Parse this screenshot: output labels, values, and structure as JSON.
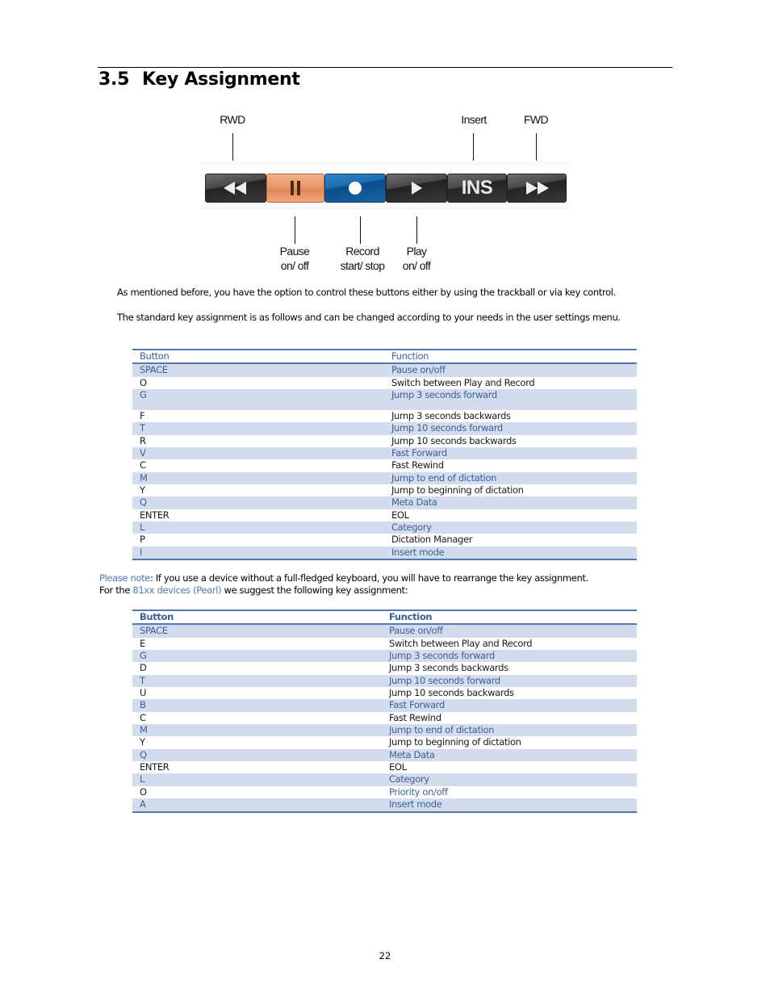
{
  "section": {
    "number": "3.5",
    "title": "Key Assignment"
  },
  "toolbar": {
    "buttons": [
      {
        "name": "rwd",
        "icon": "rewind-icon",
        "style": "dark",
        "label": ""
      },
      {
        "name": "pause",
        "icon": "pause-icon",
        "style": "orange",
        "label": ""
      },
      {
        "name": "record",
        "icon": "record-icon",
        "style": "blue",
        "label": ""
      },
      {
        "name": "play",
        "icon": "play-icon",
        "style": "dark",
        "label": ""
      },
      {
        "name": "insert",
        "icon": "insert-icon",
        "style": "dark",
        "label": "INS"
      },
      {
        "name": "fwd",
        "icon": "fast-forward-icon",
        "style": "dark",
        "label": ""
      }
    ],
    "callouts_top": {
      "rwd": "RWD",
      "insert": "Insert",
      "fwd": "FWD"
    },
    "callouts_bottom": {
      "pause": [
        "Pause",
        "on/ off"
      ],
      "record": [
        "Record",
        "start/ stop"
      ],
      "play": [
        "Play",
        "on/ off"
      ]
    }
  },
  "paragraphs": {
    "p1": "As mentioned before, you have the option to control these buttons either by using the trackball or via key control.",
    "p2": "The standard key assignment is as follows and can be changed according to your needs in the user settings menu."
  },
  "table1": {
    "headers": {
      "button": "Button",
      "function": "Function"
    },
    "rows": [
      {
        "button": "SPACE",
        "function": "Pause on/off"
      },
      {
        "button": "O",
        "function": "Switch between Play and Record"
      },
      {
        "button": "G",
        "function": "Jump 3 seconds forward"
      },
      {
        "button": "F",
        "function": "Jump 3 seconds backwards"
      },
      {
        "button": "T",
        "function": "Jump 10 seconds forward"
      },
      {
        "button": "R",
        "function": "Jump 10 seconds backwards"
      },
      {
        "button": "V",
        "function": "Fast Forward"
      },
      {
        "button": "C",
        "function": "Fast Rewind"
      },
      {
        "button": "M",
        "function": "Jump to end of dictation"
      },
      {
        "button": "Y",
        "function": "Jump to beginning of dictation"
      },
      {
        "button": "Q",
        "function": "Meta Data"
      },
      {
        "button": "ENTER",
        "function": "EOL"
      },
      {
        "button": "L",
        "function": "Category"
      },
      {
        "button": "P",
        "function": "Dictation Manager"
      },
      {
        "button": "I",
        "function": "Insert mode"
      }
    ]
  },
  "note": {
    "label": "Please note",
    "text": ": If you use a device without a full-fledged keyboard, you will have to rearrange the key assignment.",
    "line2_prefix": "For the ",
    "link": "81xx devices (Pearl)",
    "line2_suffix": " we suggest the following key assignment:"
  },
  "table2": {
    "headers": {
      "button": "Button",
      "function": "Function"
    },
    "rows": [
      {
        "button": "SPACE",
        "function": "Pause on/off"
      },
      {
        "button": "E",
        "function": "Switch between Play and Record"
      },
      {
        "button": "G",
        "function": "Jump 3 seconds forward"
      },
      {
        "button": "D",
        "function": "Jump 3 seconds backwards"
      },
      {
        "button": "T",
        "function": "Jump 10 seconds forward"
      },
      {
        "button": "U",
        "function": "Jump 10 seconds backwards"
      },
      {
        "button": "B",
        "function": "Fast Forward"
      },
      {
        "button": "C",
        "function": "Fast Rewind"
      },
      {
        "button": "M",
        "function": "Jump to end of dictation"
      },
      {
        "button": "Y",
        "function": "Jump to beginning of dictation"
      },
      {
        "button": "Q",
        "function": "Meta Data"
      },
      {
        "button": "ENTER",
        "function": "EOL"
      },
      {
        "button": "L",
        "function": "Category"
      },
      {
        "button": "O",
        "function": "Priority on/off"
      },
      {
        "button": "A",
        "function": "Insert mode"
      }
    ]
  },
  "colors": {
    "accent": "#4f7ab8",
    "row_shade": "#d2dcec",
    "shaded_text": "#3c5f96",
    "link": "#4a7ab8"
  },
  "page_number": "22"
}
